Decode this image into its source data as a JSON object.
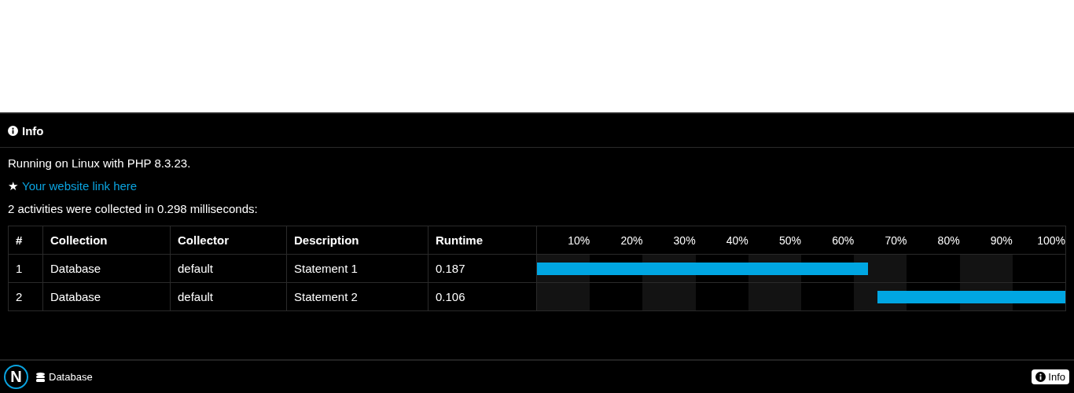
{
  "panel": {
    "title": "Info"
  },
  "info_lines": [
    {
      "kind": "text",
      "text": "Running on Linux with PHP 8.3.23."
    },
    {
      "kind": "link",
      "prefix": "★",
      "text": "Your website link here"
    },
    {
      "kind": "text",
      "text": "2 activities were collected in 0.298 milliseconds:"
    }
  ],
  "table": {
    "columns": [
      "#",
      "Collection",
      "Collector",
      "Description",
      "Runtime"
    ],
    "ticks": [
      "10%",
      "20%",
      "30%",
      "40%",
      "50%",
      "60%",
      "70%",
      "80%",
      "90%",
      "100%"
    ],
    "rows": [
      {
        "cells": [
          "1",
          "Database",
          "default",
          "Statement 1",
          "0.187"
        ],
        "level": 0.627
      },
      {
        "cells": [
          "2",
          "Database",
          "default",
          "Statement 2",
          "0.106"
        ],
        "level": 0.356
      }
    ]
  },
  "footer": {
    "logo": "N",
    "items": [
      {
        "label": "Database"
      }
    ],
    "right_button": "Info"
  }
}
